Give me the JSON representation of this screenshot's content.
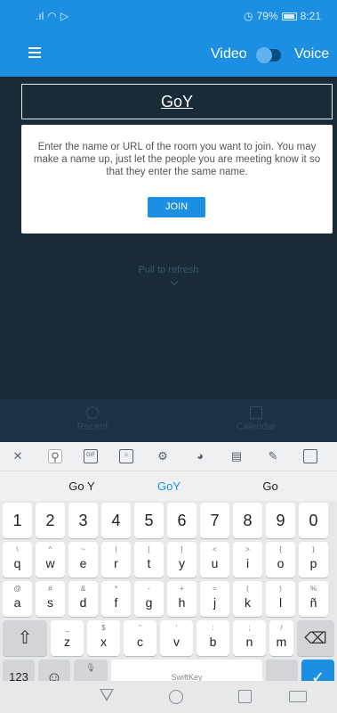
{
  "status": {
    "left_icons": [
      "signal-icon",
      "wifi-icon",
      "cast-icon"
    ],
    "alarm_icon": "alarm-icon",
    "battery": "79%",
    "time": "8:21"
  },
  "appbar": {
    "menu_icon": "menu-icon",
    "video_label": "Video",
    "voice_label": "Voice",
    "toggle_state": "voice"
  },
  "room": {
    "value": "GoY"
  },
  "card": {
    "text": "Enter the name or URL of the room you want to join. You may make a name up, just let the people you are meeting know it so that they enter the same name.",
    "join_label": "JOIN"
  },
  "pull_text": "Pull to refresh",
  "bottom_nav": {
    "recent": "Recent",
    "calendar": "Calendar"
  },
  "keyboard": {
    "toolbar": [
      "close-icon",
      "search-icon",
      "gif-icon",
      "sticker-icon",
      "settings-icon",
      "theme-icon",
      "clipboard-icon",
      "pin-icon",
      "calendar-icon"
    ],
    "suggestions": [
      "Go Y",
      "GoY",
      "Go"
    ],
    "number_row": [
      "1",
      "2",
      "3",
      "4",
      "5",
      "6",
      "7",
      "8",
      "9",
      "0"
    ],
    "row1": [
      {
        "main": "q",
        "sub": "\\"
      },
      {
        "main": "w",
        "sub": "^"
      },
      {
        "main": "e",
        "sub": "~"
      },
      {
        "main": "r",
        "sub": "|"
      },
      {
        "main": "t",
        "sub": "["
      },
      {
        "main": "y",
        "sub": "]"
      },
      {
        "main": "u",
        "sub": "<"
      },
      {
        "main": "i",
        "sub": ">"
      },
      {
        "main": "o",
        "sub": "{"
      },
      {
        "main": "p",
        "sub": "}"
      }
    ],
    "row2": [
      {
        "main": "a",
        "sub": "@"
      },
      {
        "main": "s",
        "sub": "#"
      },
      {
        "main": "d",
        "sub": "&"
      },
      {
        "main": "f",
        "sub": "*"
      },
      {
        "main": "g",
        "sub": "-"
      },
      {
        "main": "h",
        "sub": "+"
      },
      {
        "main": "j",
        "sub": "="
      },
      {
        "main": "k",
        "sub": "("
      },
      {
        "main": "l",
        "sub": ")"
      },
      {
        "main": "ñ",
        "sub": "%"
      }
    ],
    "row3": [
      {
        "main": "z",
        "sub": "_"
      },
      {
        "main": "x",
        "sub": "$"
      },
      {
        "main": "c",
        "sub": "\""
      },
      {
        "main": "v",
        "sub": "'"
      },
      {
        "main": "b",
        "sub": ":"
      },
      {
        "main": "n",
        "sub": ";"
      },
      {
        "main": "m",
        "sub": "/"
      }
    ],
    "shift_icon": "shift-icon",
    "backspace_icon": "backspace-icon",
    "numbers_label": "123",
    "emoji_icon": "emoji-icon",
    "comma_label": ",",
    "mic_icon": "mic-icon",
    "space_label": "SwiftKey",
    "period_label": ".",
    "enter_icon": "checkmark-icon"
  },
  "system_nav": [
    "back-icon",
    "home-icon",
    "recent-apps-icon",
    "keyboard-icon"
  ],
  "colors": {
    "accent": "#1c8fe3",
    "background": "#1a2b38"
  }
}
